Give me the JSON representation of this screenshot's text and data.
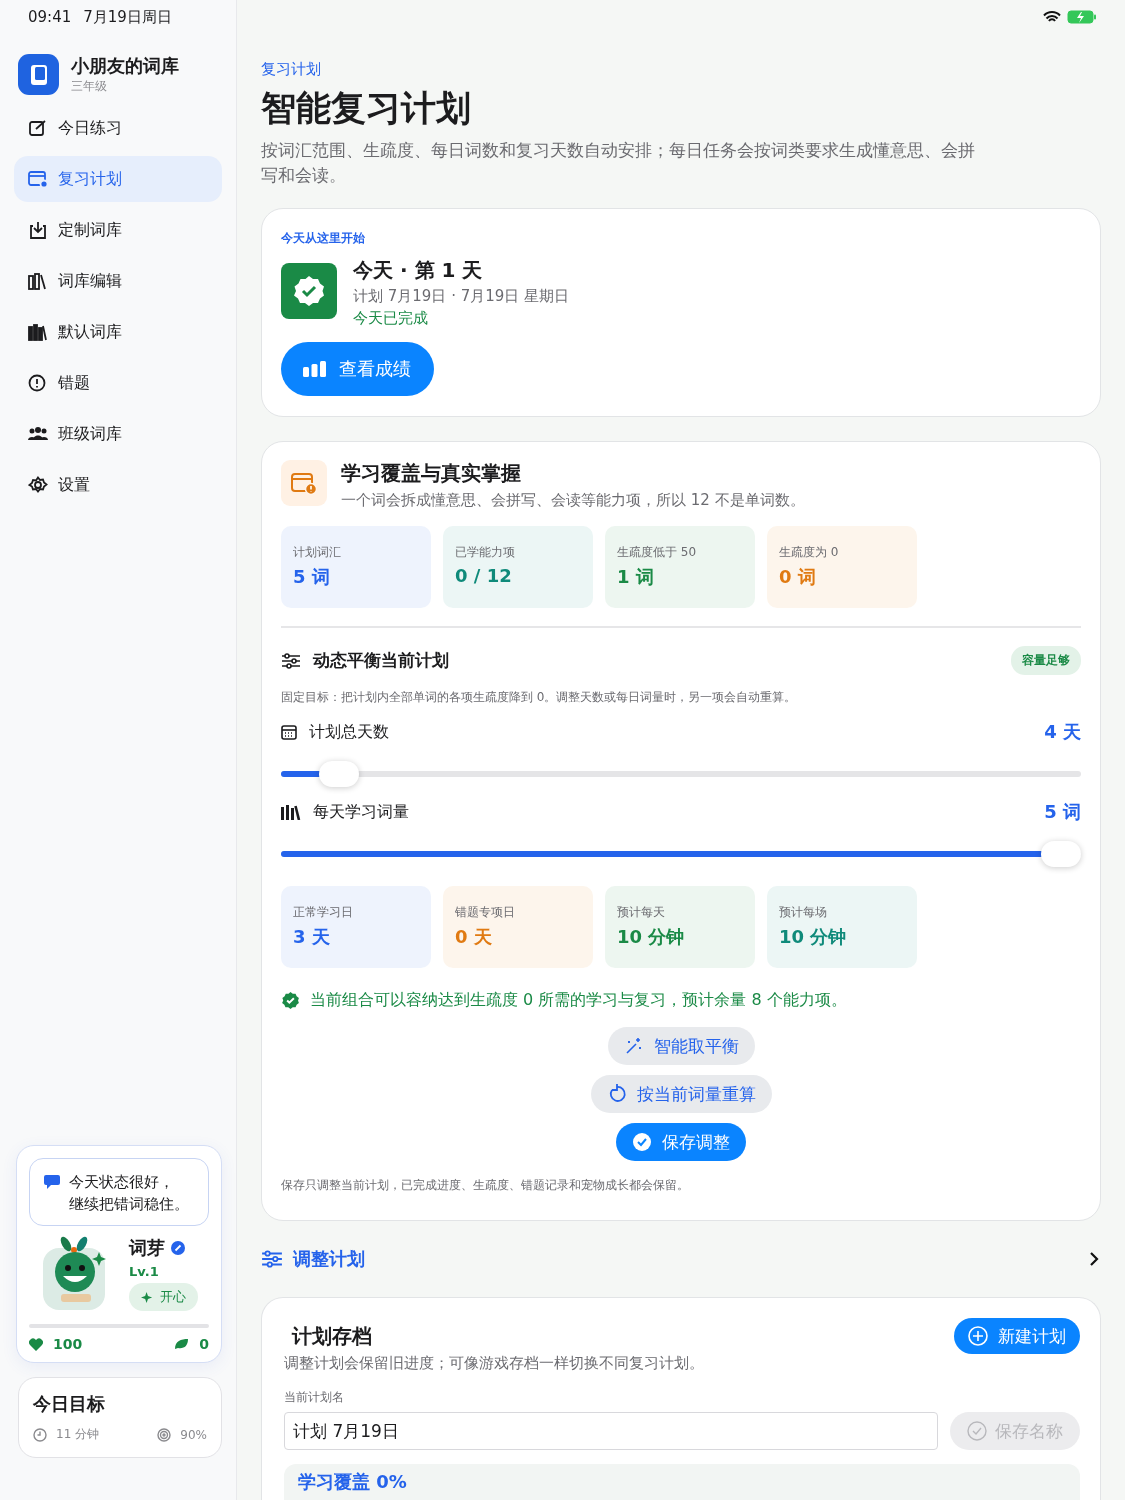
{
  "status_bar": {
    "time": "09:41",
    "date": "7月19日周日"
  },
  "sidebar": {
    "app_name": "小朋友的词库",
    "grade": "三年级",
    "items": [
      {
        "label": "今日练习",
        "selected": false
      },
      {
        "label": "复习计划",
        "selected": true
      },
      {
        "label": "定制词库",
        "selected": false
      },
      {
        "label": "词库编辑",
        "selected": false
      },
      {
        "label": "默认词库",
        "selected": false
      },
      {
        "label": "错题",
        "selected": false
      },
      {
        "label": "班级词库",
        "selected": false
      },
      {
        "label": "设置",
        "selected": false
      }
    ]
  },
  "pet": {
    "message_lines": [
      "今天状态很好，",
      "继续把错词稳住。"
    ],
    "name": "词芽",
    "level_text": "Lv.1",
    "mood": "开心",
    "hearts": "100",
    "leaves": "0"
  },
  "daily_goal": {
    "title": "今日目标",
    "minutes": "11 分钟",
    "accuracy": "90%"
  },
  "breadcrumb": "复习计划",
  "title": "智能复习计划",
  "description": "按词汇范围、生疏度、每日词数和复习天数自动安排；每日任务会按词类要求生成懂意思、会拼写和会读。",
  "today_card": {
    "eyebrow": "今天从这里开始",
    "title": "今天 · 第 1 天",
    "subtitle": "计划 7月19日 · 7月19日 星期日",
    "status": "今天已完成",
    "button": "查看成绩"
  },
  "coverage": {
    "title": "学习覆盖与真实掌握",
    "subtitle": "一个词会拆成懂意思、会拼写、会读等能力项，所以 12 不是单词数。",
    "stats": [
      {
        "label": "计划词汇",
        "value": "5 词",
        "color": "#2563eb"
      },
      {
        "label": "已学能力项",
        "value": "0 / 12",
        "color": "#0f8a7a"
      },
      {
        "label": "生疏度低于 50",
        "value": "1 词",
        "color": "#1a8a46"
      },
      {
        "label": "生疏度为 0",
        "value": "0 词",
        "color": "#e07a12"
      }
    ]
  },
  "balance": {
    "title": "动态平衡当前计划",
    "badge": "容量足够",
    "note": "固定目标：把计划内全部单词的各项生疏度降到 0。调整天数或每日词量时，另一项会自动重算。",
    "sliders": [
      {
        "label": "计划总天数",
        "reading": "4 天",
        "level": 0.05
      },
      {
        "label": "每天学习词量",
        "reading": "5 词",
        "level": 1
      }
    ],
    "stats": [
      {
        "label": "正常学习日",
        "value": "3 天",
        "color": "#2563eb"
      },
      {
        "label": "错题专项日",
        "value": "0 天",
        "color": "#e07a12"
      },
      {
        "label": "预计每天",
        "value": "10 分钟",
        "color": "#1a8a46"
      },
      {
        "label": "预计每场",
        "value": "10 分钟",
        "color": "#0f8a7a"
      }
    ],
    "result": "当前组合可以容纳达到生疏度 0 所需的学习与复习，预计余量 8 个能力项。",
    "actions": [
      {
        "label": "智能取平衡",
        "kind": "secondary"
      },
      {
        "label": "按当前词量重算",
        "kind": "secondary"
      },
      {
        "label": "保存调整",
        "kind": "primary"
      }
    ],
    "footnote": "保存只调整当前计划，已完成进度、生疏度、错题记录和宠物成长都会保留。"
  },
  "adjust_link": "调整计划",
  "archive": {
    "title": "计划存档",
    "new_button": "新建计划",
    "description": "调整计划会保留旧进度；可像游戏存档一样切换不同复习计划。",
    "name_label": "当前计划名",
    "name_value": "计划 7月19日",
    "save_button": {
      "label": "保存名称",
      "disabled": true
    },
    "coverage_label": "学习覆盖 0%"
  }
}
